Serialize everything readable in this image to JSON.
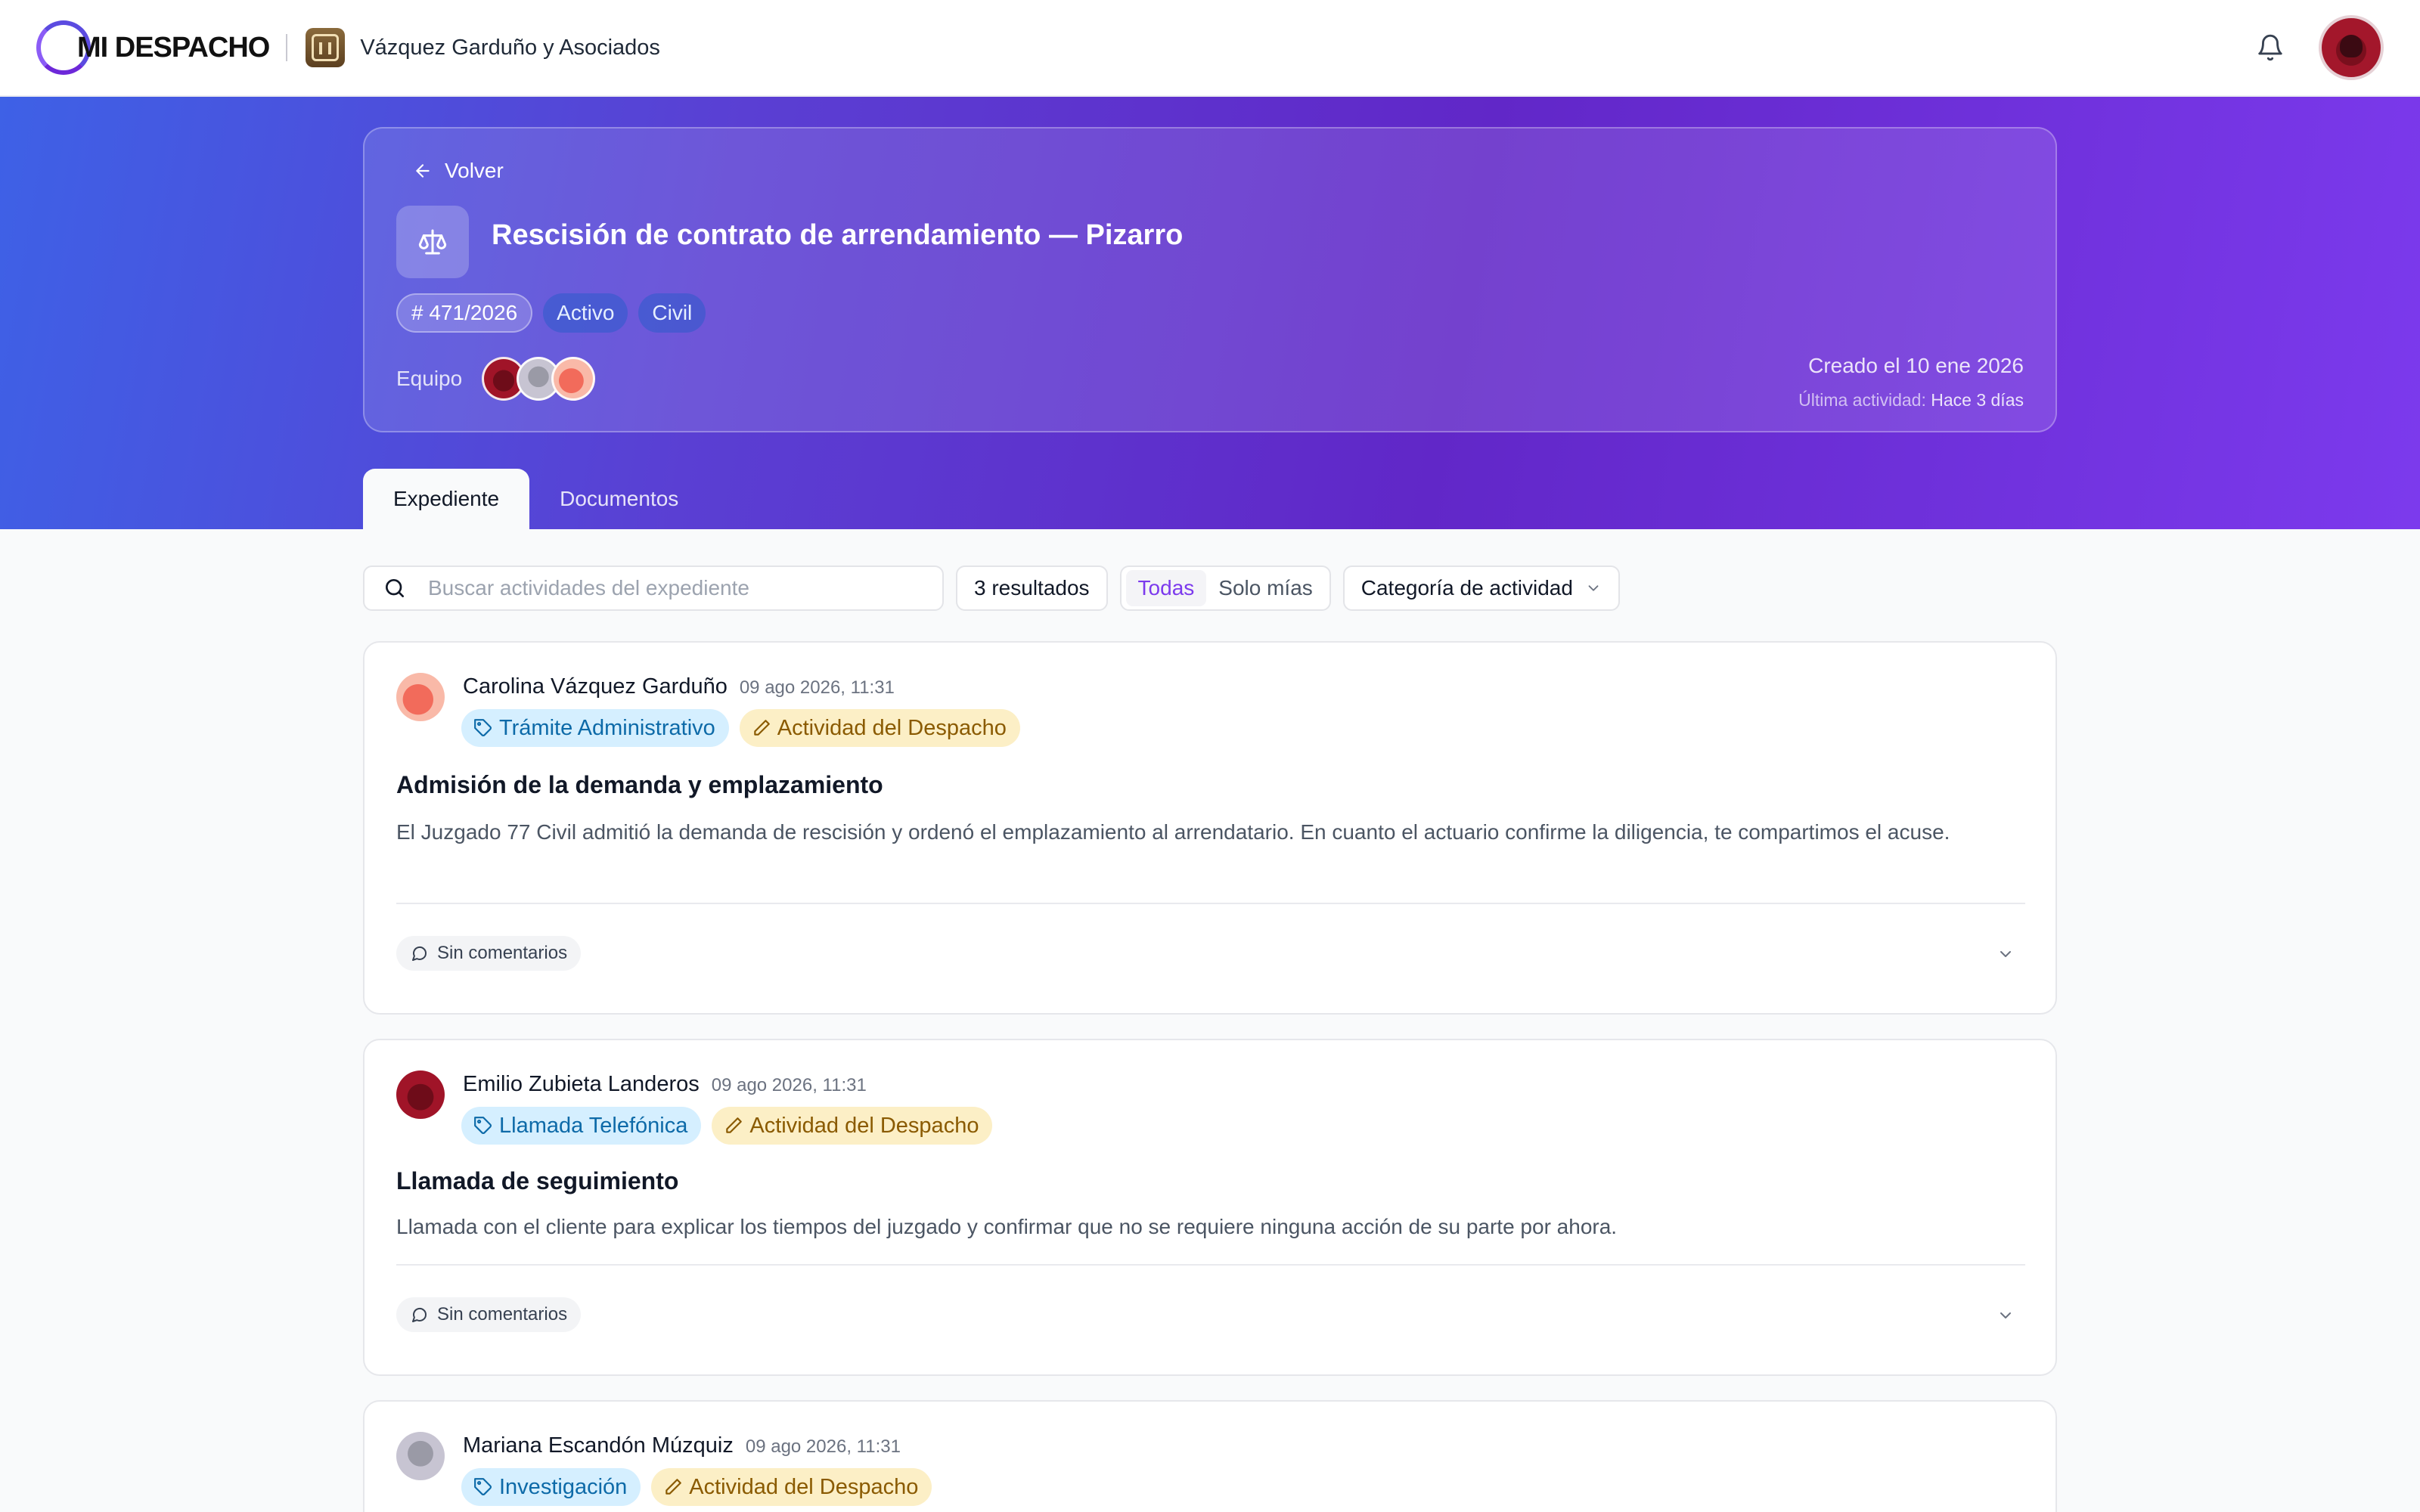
{
  "header": {
    "brand": "MI DESPACHO",
    "firm_name": "Vázquez Garduño y Asociados",
    "icons": {
      "notifications": "bell-icon",
      "user": "user-avatar"
    }
  },
  "case": {
    "back_label": "Volver",
    "title": "Rescisión de contrato de arrendamiento — Pizarro",
    "number": "# 471/2026",
    "status": "Activo",
    "area": "Civil",
    "team_label": "Equipo",
    "created": "Creado el 10 ene 2026",
    "last_activity_label": "Última actividad:",
    "last_activity_value": "Hace 3 días",
    "icon": "scales-icon"
  },
  "tabs": [
    {
      "label": "Expediente",
      "active": true
    },
    {
      "label": "Documentos",
      "active": false
    }
  ],
  "filters": {
    "search_placeholder": "Buscar actividades del expediente",
    "results": "3 resultados",
    "scope_all": "Todas",
    "scope_mine": "Solo mías",
    "category_label": "Categoría de actividad"
  },
  "activities": [
    {
      "author": "Carolina Vázquez Garduño",
      "date": "09 ago 2026, 11:31",
      "category": "Trámite Administrativo",
      "kind": "Actividad del Despacho",
      "title": "Admisión de la demanda y emplazamiento",
      "body": "El Juzgado 77 Civil admitió la demanda de rescisión y ordenó el emplazamiento al arrendatario. En cuanto el actuario confirme la diligencia, te compartimos el acuse.",
      "comments": "Sin comentarios"
    },
    {
      "author": "Emilio Zubieta Landeros",
      "date": "09 ago 2026, 11:31",
      "category": "Llamada Telefónica",
      "kind": "Actividad del Despacho",
      "title": "Llamada de seguimiento",
      "body": "Llamada con el cliente para explicar los tiempos del juzgado y confirmar que no se requiere ninguna acción de su parte por ahora.",
      "comments": "Sin comentarios"
    },
    {
      "author": "Mariana Escandón Múzquiz",
      "date": "09 ago 2026, 11:31",
      "category": "Investigación",
      "kind": "Actividad del Despacho"
    }
  ],
  "colors": {
    "accent": "#7c3aed",
    "hero_start": "#3e61e6",
    "hero_end": "#7c3aed"
  }
}
